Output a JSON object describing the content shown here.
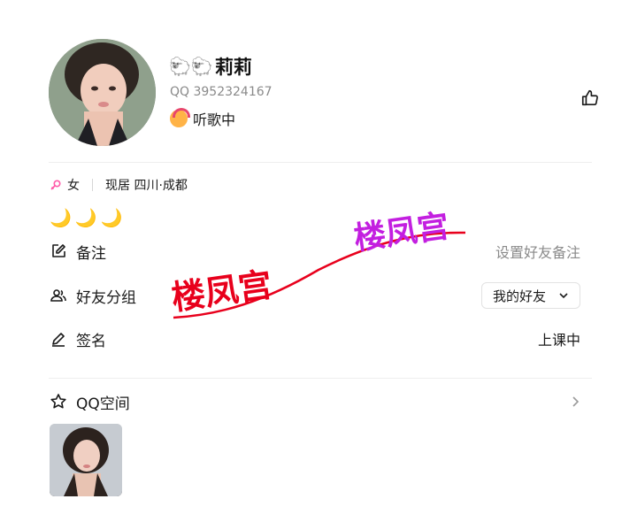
{
  "profile": {
    "nickname_emoji": "🐑🐑",
    "nickname": "莉莉",
    "qq_label": "QQ 3952324167",
    "status": "听歌中"
  },
  "info": {
    "gender_icon": "female-icon",
    "gender": "女",
    "location": "现居 四川·成都"
  },
  "moons": "🌙🌙🌙",
  "rows": {
    "remark_label": "备注",
    "remark_value": "设置好友备注",
    "group_label": "好友分组",
    "group_value": "我的好友",
    "signature_label": "签名",
    "signature_value": "上课中",
    "qzone_label": "QQ空间"
  },
  "watermark": {
    "text_1": "楼凤宫",
    "text_2": "楼凤宫",
    "color_1": "#e8001c",
    "color_2": "#c31fe0"
  },
  "colors": {
    "accent_female": "#ff5aa8",
    "muted": "#8a8a8a"
  }
}
